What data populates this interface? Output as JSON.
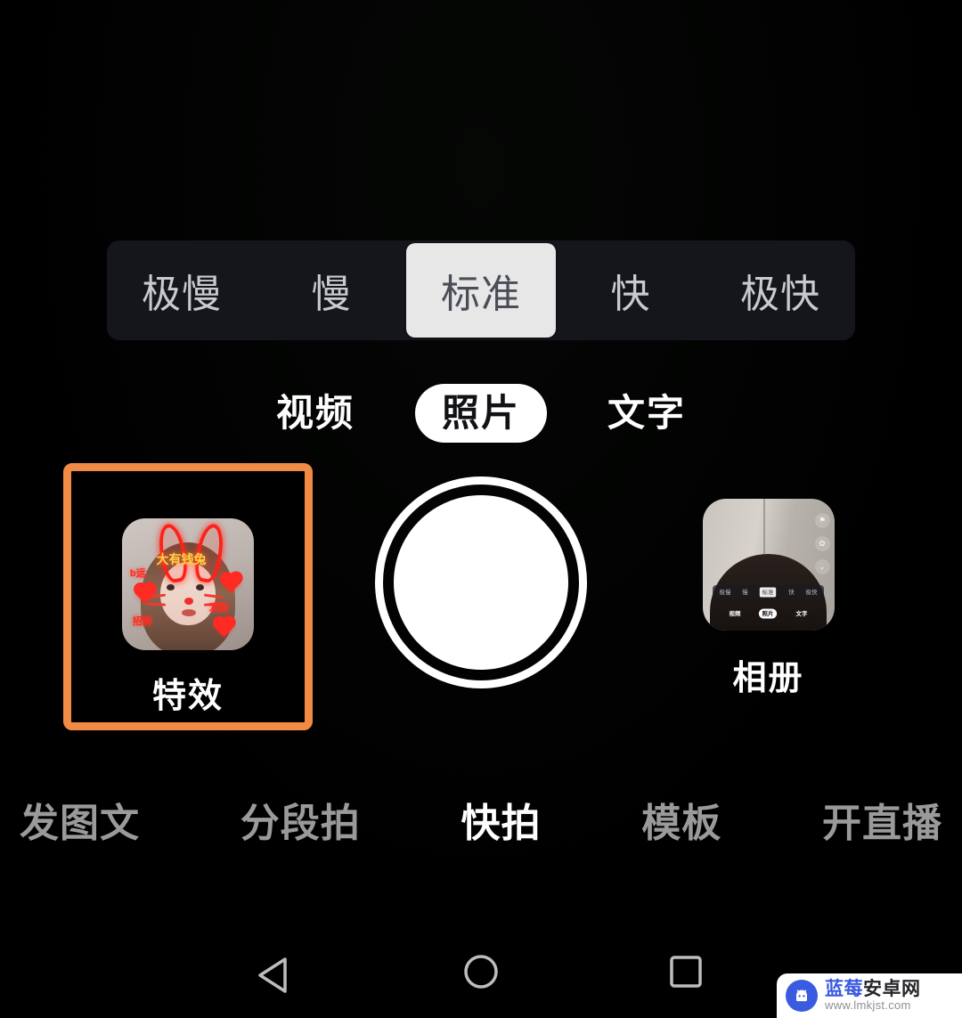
{
  "app": {
    "screen_name": "camera-capture-screen",
    "background_color": "#000000"
  },
  "speed_bar": {
    "background_color": "#14161c",
    "selected_pill_color": "#e7e7e8",
    "selected_text_color": "#4b4e56",
    "inactive_text_color": "#c9cace",
    "selected": "标准",
    "items": [
      {
        "label": "极慢",
        "selected": false
      },
      {
        "label": "慢",
        "selected": false
      },
      {
        "label": "标准",
        "selected": true
      },
      {
        "label": "快",
        "selected": false
      },
      {
        "label": "极快",
        "selected": false
      }
    ]
  },
  "mode_tabs": {
    "selected": "照片",
    "items": [
      {
        "label": "视频",
        "selected": false
      },
      {
        "label": "照片",
        "selected": true
      },
      {
        "label": "文字",
        "selected": false
      }
    ]
  },
  "capture_row": {
    "effects": {
      "label": "特效",
      "highlighted": true,
      "highlight_color": "#f08a45",
      "thumbnail_stickers": {
        "text_1": "b运",
        "text_2": "大有钱兔",
        "text_3": "发财",
        "text_4": "招财"
      }
    },
    "shutter": {
      "name": "快门",
      "color": "#ffffff"
    },
    "album": {
      "label": "相册",
      "thumbnail_mini_speed": [
        "极慢",
        "慢",
        "标准",
        "快",
        "极快"
      ],
      "thumbnail_mini_speed_selected": "标准",
      "thumbnail_mini_modes": [
        "视频",
        "照片",
        "文字"
      ],
      "thumbnail_mini_modes_selected": "照片",
      "thumbnail_icons": [
        "flash-icon",
        "beauty-icon",
        "settings-icon"
      ]
    }
  },
  "bottom_nav": {
    "active": "快拍",
    "active_color": "#ffffff",
    "inactive_color": "#9a9a9a",
    "items": [
      {
        "label": "发图文",
        "active": false
      },
      {
        "label": "分段拍",
        "active": false
      },
      {
        "label": "快拍",
        "active": true
      },
      {
        "label": "模板",
        "active": false
      },
      {
        "label": "开直播",
        "active": false
      }
    ]
  },
  "system_nav": {
    "back": "back-triangle-icon",
    "home": "home-circle-icon",
    "recents": "recents-square-icon",
    "icon_color": "#bdbdbd"
  },
  "watermark": {
    "title_primary": "蓝莓",
    "title_secondary": "安卓网",
    "url": "www.lmkjst.com",
    "icon": "android-robot-icon",
    "brand_color": "#3a5ae0"
  }
}
